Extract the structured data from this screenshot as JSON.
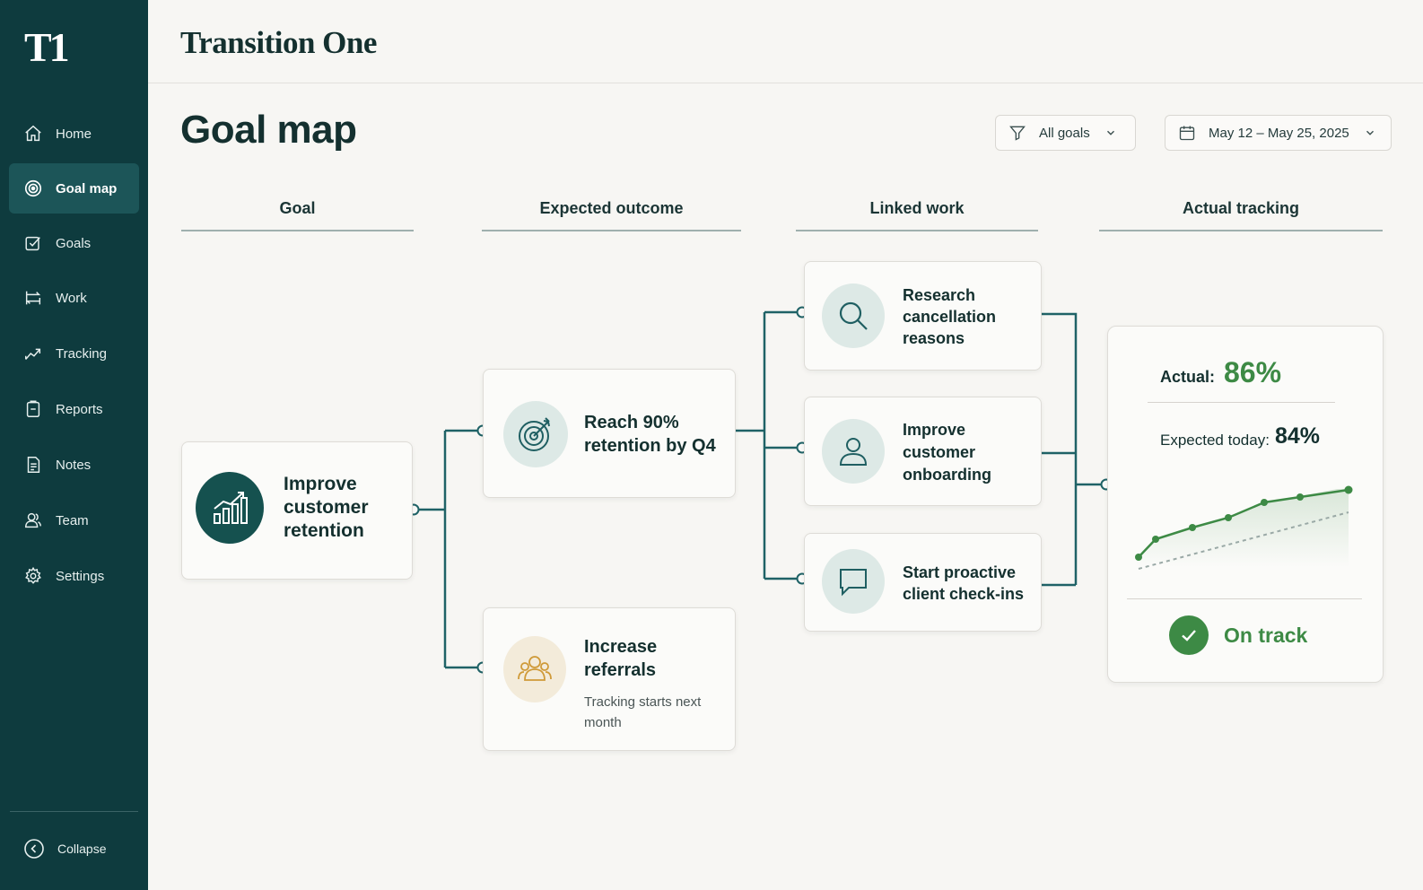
{
  "brand": {
    "logo": "T1",
    "name": "Transition One"
  },
  "sidebar": {
    "items": [
      {
        "label": "Home",
        "icon": "home-icon"
      },
      {
        "label": "Goal map",
        "icon": "target-icon",
        "active": true
      },
      {
        "label": "Goals",
        "icon": "goals-icon"
      },
      {
        "label": "Work",
        "icon": "work-icon"
      },
      {
        "label": "Tracking",
        "icon": "tracking-icon"
      },
      {
        "label": "Reports",
        "icon": "reports-icon"
      },
      {
        "label": "Notes",
        "icon": "notes-icon"
      },
      {
        "label": "Team",
        "icon": "team-icon"
      },
      {
        "label": "Settings",
        "icon": "gear-icon"
      }
    ],
    "collapse_label": "Collapse"
  },
  "page": {
    "title": "Goal map"
  },
  "filters": {
    "goals_label": "All goals",
    "date_range": "May 12 – May 25, 2025"
  },
  "columns": [
    "Goal",
    "Expected outcome",
    "Linked work",
    "Actual tracking"
  ],
  "goal": {
    "title": "Improve customer retention"
  },
  "outcomes": [
    {
      "title": "Reach 90% retention by Q4"
    },
    {
      "title": "Increase referrals",
      "note": "Tracking starts next month"
    }
  ],
  "linked_work": [
    {
      "title": "Research cancellation reasons"
    },
    {
      "title": "Improve customer onboarding"
    },
    {
      "title": "Start proactive client check-ins"
    }
  ],
  "tracking": {
    "actual_label": "Actual:",
    "actual_value": "86%",
    "expected_label": "Expected today:",
    "expected_value": "84%",
    "status": "On track",
    "colors": {
      "actual": "#3d8a45",
      "expected": "#9aa9a6"
    }
  }
}
